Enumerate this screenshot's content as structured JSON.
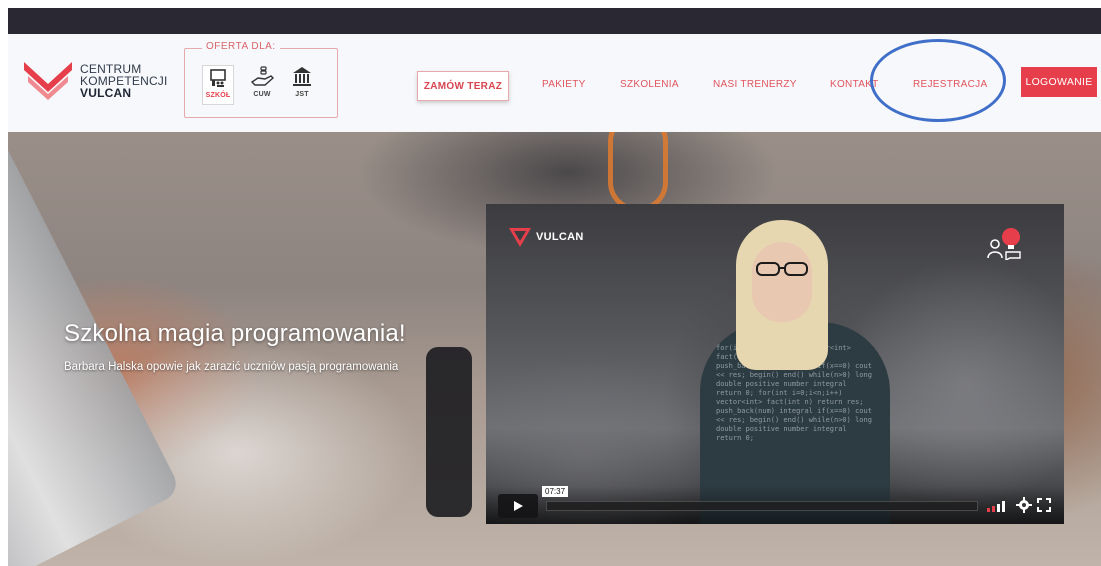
{
  "header": {
    "logo": {
      "line1": "CENTRUM",
      "line2": "KOMPETENCJI",
      "line3": "VULCAN"
    },
    "oferta": {
      "title": "OFERTA DLA:",
      "items": [
        {
          "label": "SZKÓŁ",
          "icon": "school-icon",
          "active": true
        },
        {
          "label": "CUW",
          "icon": "hand-coins-icon",
          "active": false
        },
        {
          "label": "JST",
          "icon": "building-columns-icon",
          "active": false
        }
      ]
    },
    "order_button": "ZAMÓW TERAZ",
    "nav": [
      "PAKIETY",
      "SZKOLENIA",
      "NASI TRENERZY",
      "KONTAKT",
      "REJESTRACJA"
    ],
    "login_button": "LOGOWANIE",
    "highlighted_item": "REJESTRACJA",
    "colors": {
      "accent": "#e63f4b",
      "highlight_circle": "#3f6fc9",
      "top_strip": "#2a2833"
    }
  },
  "hero": {
    "title": "Szkolna magia programowania!",
    "subtitle": "Barbara Halska opowie jak zarazić uczniów pasją programowania"
  },
  "video": {
    "brand": "VULCAN",
    "timecode": "07:37",
    "progress_fraction": 0.0
  }
}
